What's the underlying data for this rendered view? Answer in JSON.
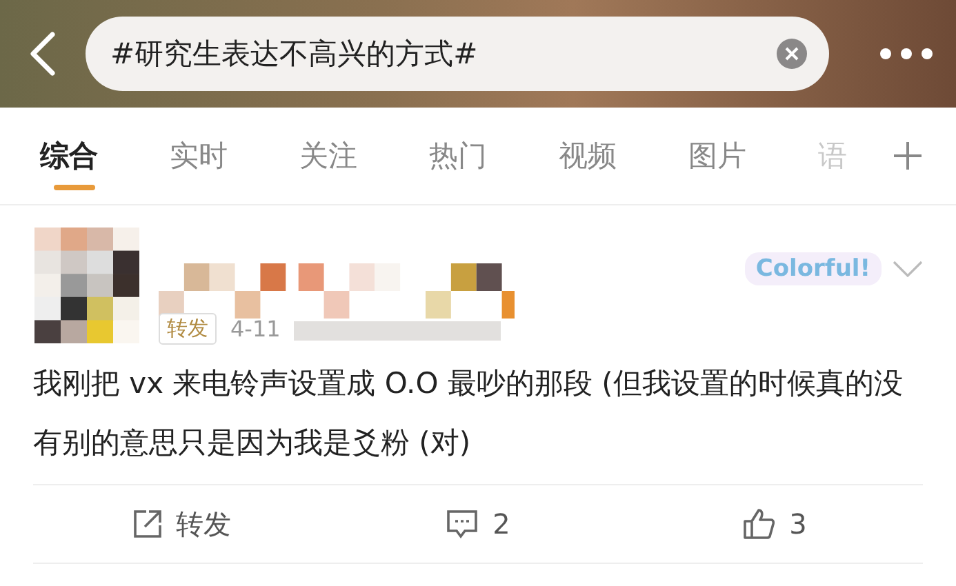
{
  "search": {
    "value": "#研究生表达不高兴的方式#"
  },
  "tabs": [
    {
      "label": "综合",
      "selected": true
    },
    {
      "label": "实时",
      "selected": false
    },
    {
      "label": "关注",
      "selected": false
    },
    {
      "label": "热门",
      "selected": false
    },
    {
      "label": "视频",
      "selected": false
    },
    {
      "label": "图片",
      "selected": false
    },
    {
      "label": "语",
      "selected": false
    }
  ],
  "post": {
    "badge": "Colorful!",
    "tag": "转发",
    "date": "4-11",
    "text": "我刚把 vx 来电铃声设置成 O.O 最吵的那段 (但我设置的时候真的没有别的意思只是因为我是爻粉 (对)",
    "actions": [
      {
        "kind": "repost",
        "label": "转发"
      },
      {
        "kind": "comment",
        "label": "2"
      },
      {
        "kind": "like",
        "label": "3"
      }
    ]
  }
}
